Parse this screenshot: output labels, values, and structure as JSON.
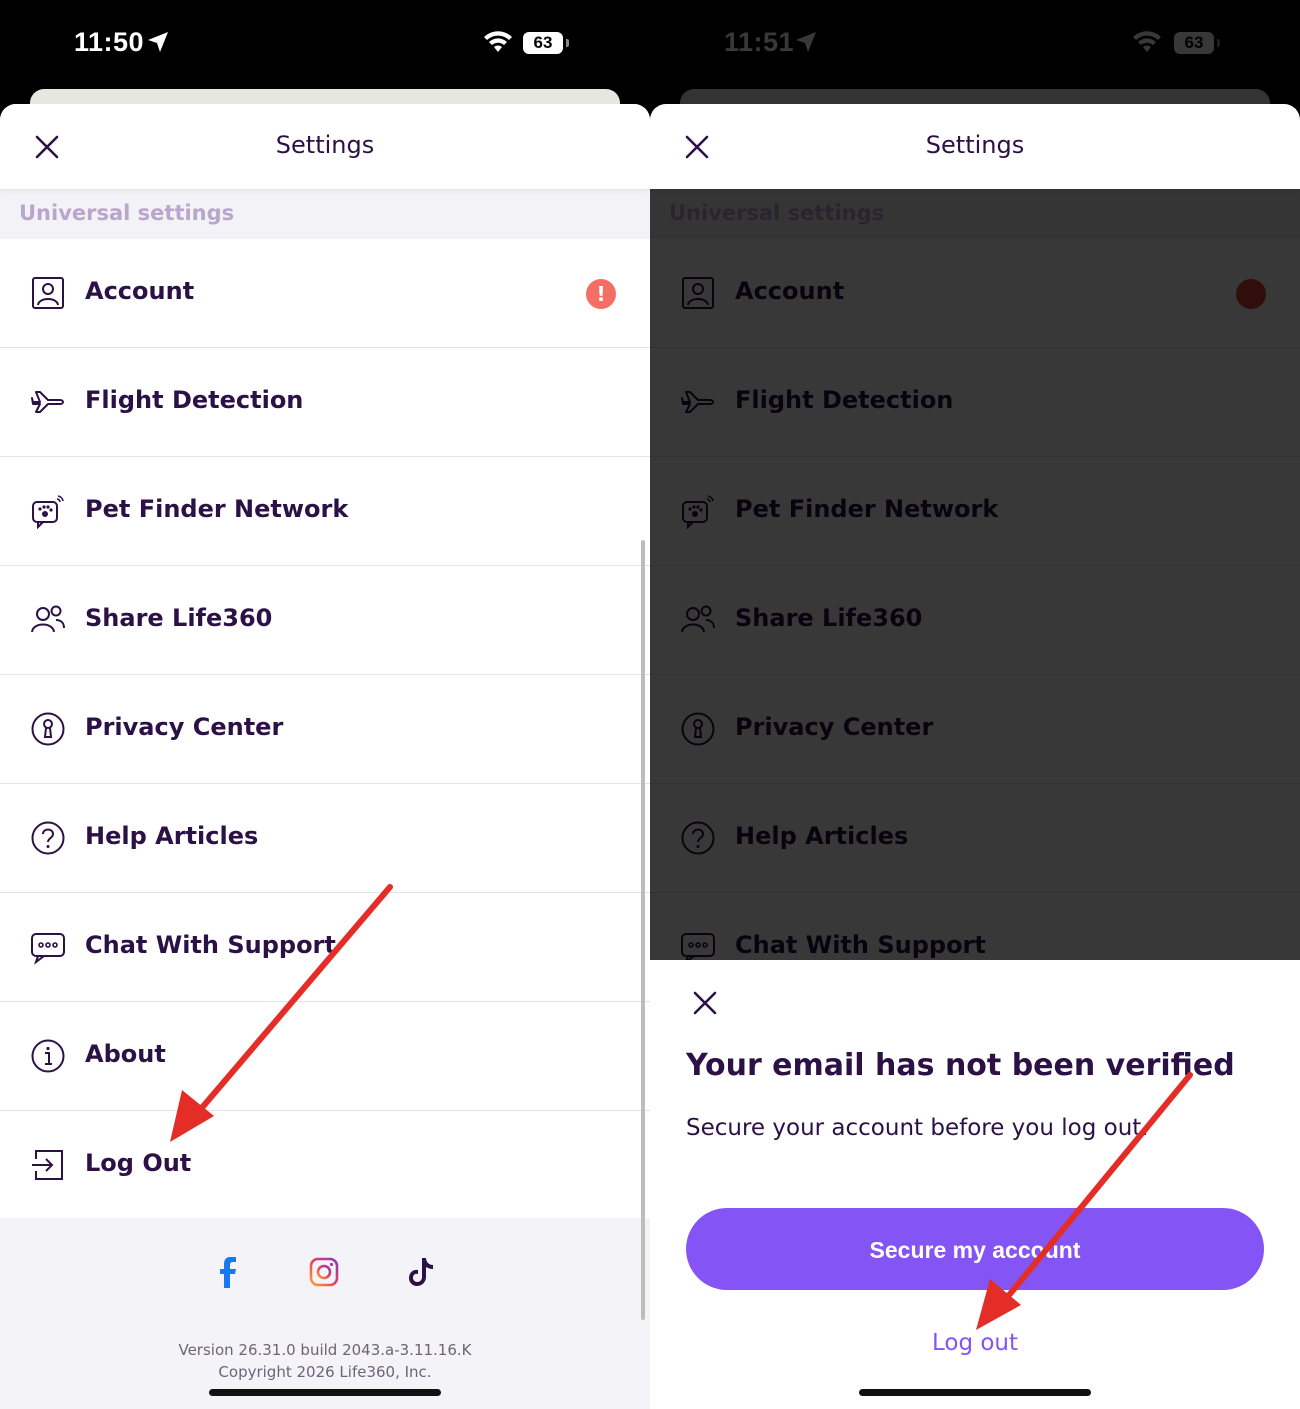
{
  "left": {
    "status": {
      "time": "11:50",
      "battery": "63"
    },
    "header": {
      "title": "Settings"
    },
    "section": "Universal settings",
    "items": [
      {
        "label": "Account",
        "icon": "person-square-icon",
        "alert": "!"
      },
      {
        "label": "Flight Detection",
        "icon": "airplane-icon"
      },
      {
        "label": "Pet Finder Network",
        "icon": "pet-finder-icon"
      },
      {
        "label": "Share Life360",
        "icon": "people-icon"
      },
      {
        "label": "Privacy Center",
        "icon": "keyhole-icon"
      },
      {
        "label": "Help Articles",
        "icon": "question-circle-icon"
      },
      {
        "label": "Chat With Support",
        "icon": "chat-bubble-icon"
      },
      {
        "label": "About",
        "icon": "info-circle-icon"
      },
      {
        "label": "Log Out",
        "icon": "logout-icon"
      }
    ],
    "footer": {
      "socials": [
        "facebook-icon",
        "instagram-icon",
        "tiktok-icon"
      ],
      "version": "Version 26.31.0 build 2043.a-3.11.16.K",
      "copyright": "Copyright 2026 Life360, Inc."
    }
  },
  "right": {
    "status": {
      "time": "11:51",
      "battery": "63"
    },
    "header": {
      "title": "Settings"
    },
    "section": "Universal settings",
    "items": [
      {
        "label": "Account"
      },
      {
        "label": "Flight Detection"
      },
      {
        "label": "Pet Finder Network"
      },
      {
        "label": "Share Life360"
      },
      {
        "label": "Privacy Center"
      },
      {
        "label": "Help Articles"
      },
      {
        "label": "Chat With Support"
      }
    ],
    "modal": {
      "title": "Your email has not been verified",
      "body": "Secure your account before you log out.",
      "primary_button": "Secure my account",
      "secondary_link": "Log out"
    }
  },
  "colors": {
    "brand_purple": "#8454f4",
    "text_dark": "#2b1145",
    "alert_red": "#f46e66",
    "annotation_red": "#e52d27"
  }
}
